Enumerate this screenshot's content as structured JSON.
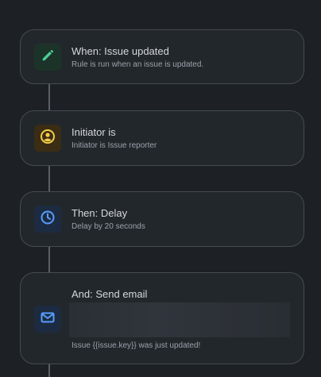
{
  "steps": [
    {
      "title": "When: Issue updated",
      "description": "Rule is run when an issue is updated.",
      "icon": "pencil-icon",
      "icon_color": "#4bce97",
      "icon_bg": "#1c3329"
    },
    {
      "title": "Initiator is",
      "description": "Initiator is Issue reporter",
      "icon": "user-circle-icon",
      "icon_color": "#f5cd47",
      "icon_bg": "#3a2d14"
    },
    {
      "title": "Then: Delay",
      "description": "Delay by 20 seconds",
      "icon": "clock-icon",
      "icon_color": "#579dff",
      "icon_bg": "#1c2b41"
    },
    {
      "title": "And: Send email",
      "description": "Issue {{issue.key}} was just updated!",
      "icon": "mail-icon",
      "icon_color": "#579dff",
      "icon_bg": "#1c2b41"
    }
  ]
}
